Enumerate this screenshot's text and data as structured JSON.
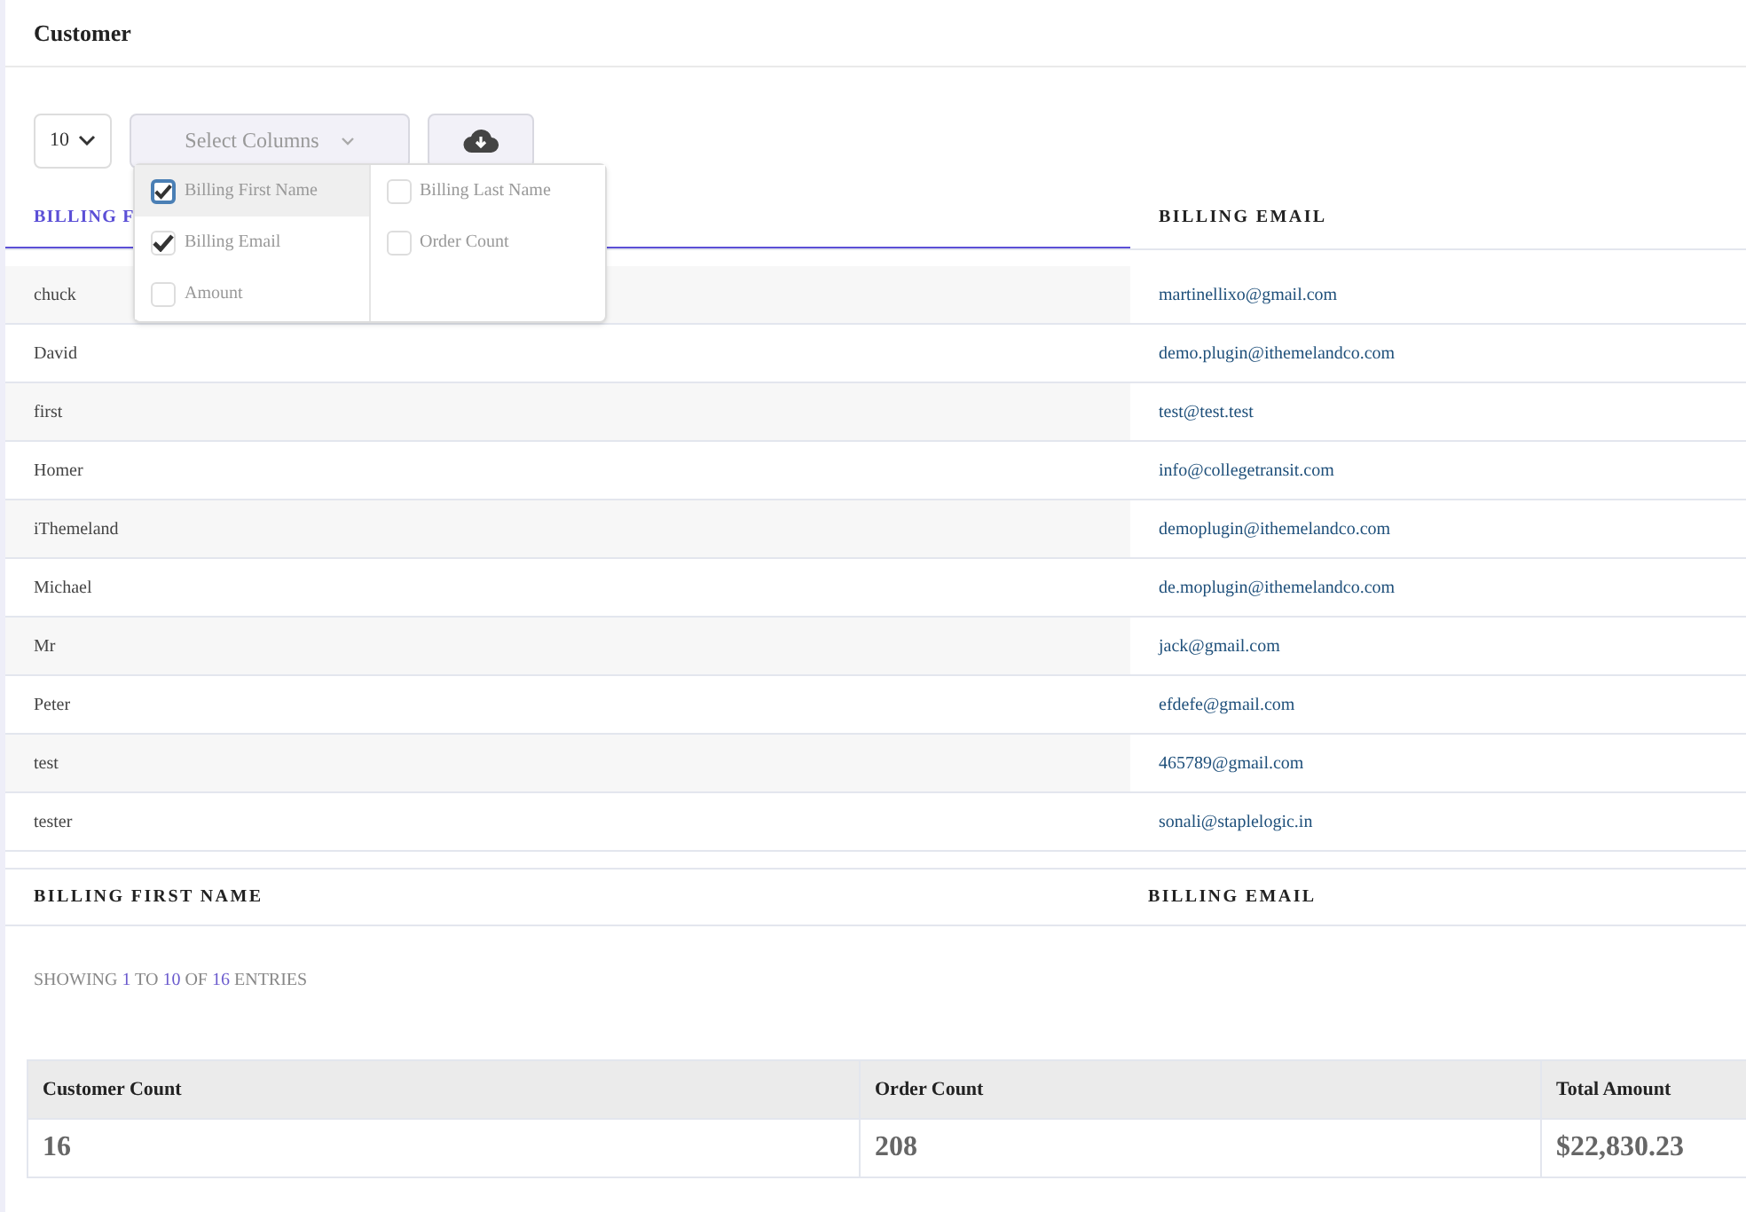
{
  "title": "Customer",
  "page_length": {
    "value": "10"
  },
  "columns_select": {
    "placeholder": "Select Columns",
    "expanded": true,
    "options": [
      {
        "label": "Billing First Name",
        "checked": true,
        "focused": true
      },
      {
        "label": "Billing Last Name",
        "checked": false,
        "focused": false
      },
      {
        "label": "Billing Email",
        "checked": true,
        "focused": false
      },
      {
        "label": "Order Count",
        "checked": false,
        "focused": false
      },
      {
        "label": "Amount",
        "checked": false,
        "focused": false
      }
    ]
  },
  "table": {
    "columns": [
      {
        "label": "BILLING F",
        "sorted": true
      },
      {
        "label": "BILLING EMAIL",
        "sorted": false
      }
    ],
    "rows": [
      [
        "chuck",
        "martinellixo@gmail.com"
      ],
      [
        "David",
        "demo.plugin@ithemelandco.com"
      ],
      [
        "first",
        "test@test.test"
      ],
      [
        "Homer",
        "info@collegetransit.com"
      ],
      [
        "iThemeland",
        "demoplugin@ithemelandco.com"
      ],
      [
        "Michael",
        "de.moplugin@ithemelandco.com"
      ],
      [
        "Mr",
        "jack@gmail.com"
      ],
      [
        "Peter",
        "efdefe@gmail.com"
      ],
      [
        "test",
        "465789@gmail.com"
      ],
      [
        "tester",
        "sonali@staplelogic.in"
      ]
    ],
    "footer": [
      "BILLING FIRST NAME",
      "BILLING EMAIL"
    ]
  },
  "info": [
    {
      "text": "SHOWING ",
      "highlight": false
    },
    {
      "text": "1",
      "highlight": true
    },
    {
      "text": " TO ",
      "highlight": false
    },
    {
      "text": "10",
      "highlight": true
    },
    {
      "text": " OF ",
      "highlight": false
    },
    {
      "text": "16",
      "highlight": true
    },
    {
      "text": " ENTRIES",
      "highlight": false
    }
  ],
  "summary": {
    "columns": [
      "Customer Count",
      "Order Count",
      "Total Amount"
    ],
    "values": [
      "16",
      "208",
      "$22,830.23"
    ]
  }
}
